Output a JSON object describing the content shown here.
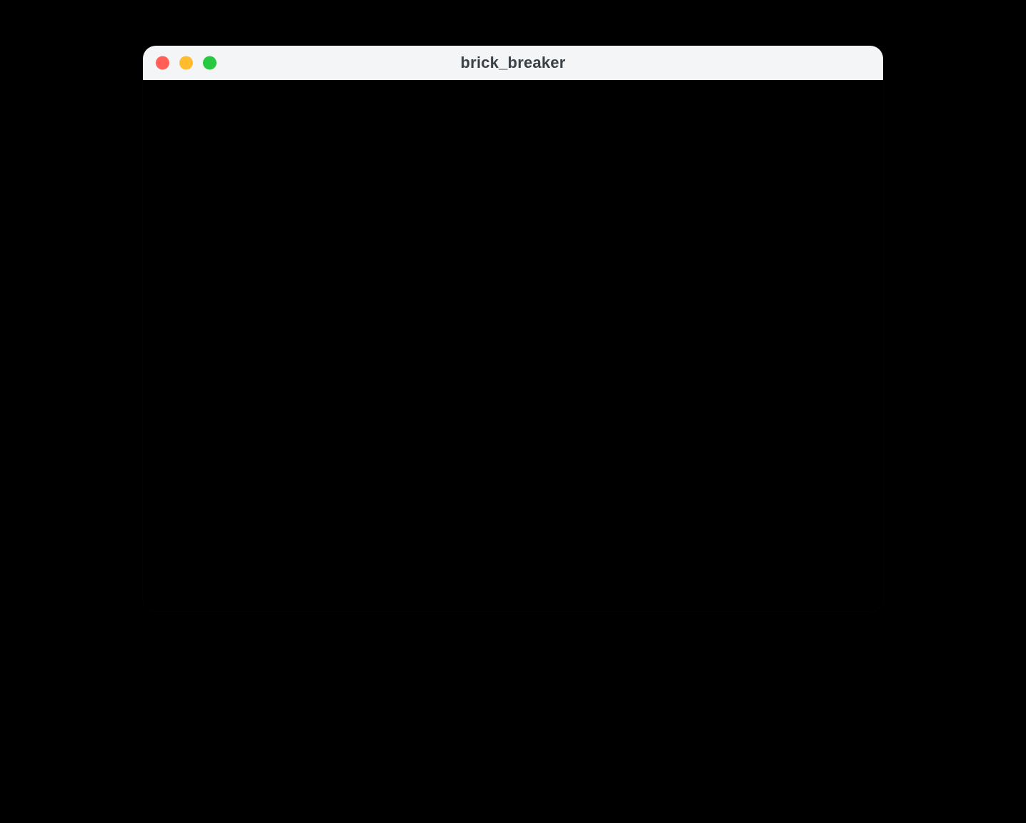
{
  "window": {
    "title": "brick_breaker",
    "traffic_lights": {
      "close_color": "#ff5f57",
      "minimize_color": "#febc2e",
      "zoom_color": "#28c840"
    }
  }
}
